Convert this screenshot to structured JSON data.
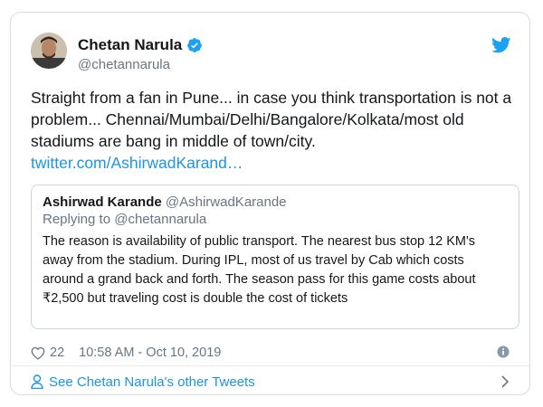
{
  "author": {
    "name": "Chetan Narula",
    "handle": "@chetannarula"
  },
  "tweet": {
    "text": "Straight from a fan in Pune... in case you think transportation is not a problem... Chennai/Mumbai/Delhi/Bangalore/Kolkata/most old stadiums are bang in middle of town/city.",
    "link": "twitter.com/AshirwadKarand…"
  },
  "quote": {
    "name": "Ashirwad Karande",
    "handle": "@AshirwadKarande",
    "replying_prefix": "Replying to",
    "replying_to": "@chetannarula",
    "body": "The reason is availability of public transport. The nearest bus stop 12 KM's away from the stadium. During IPL, most of us travel by Cab which costs around a grand back and forth. The season pass for this game costs about ₹2,500 but traveling cost is double the cost of tickets"
  },
  "meta": {
    "likes": "22",
    "timestamp": "10:58 AM - Oct 10, 2019"
  },
  "footer": {
    "label": "See Chetan Narula's other Tweets"
  },
  "icons": {
    "verified": "verified-badge-icon",
    "brand": "twitter-bird-icon",
    "like": "heart-icon",
    "info": "info-icon",
    "profile": "person-icon",
    "arrow": "chevron-right-icon"
  },
  "colors": {
    "link": "#1b95e0",
    "muted": "#657786",
    "border": "#d6dee4"
  }
}
